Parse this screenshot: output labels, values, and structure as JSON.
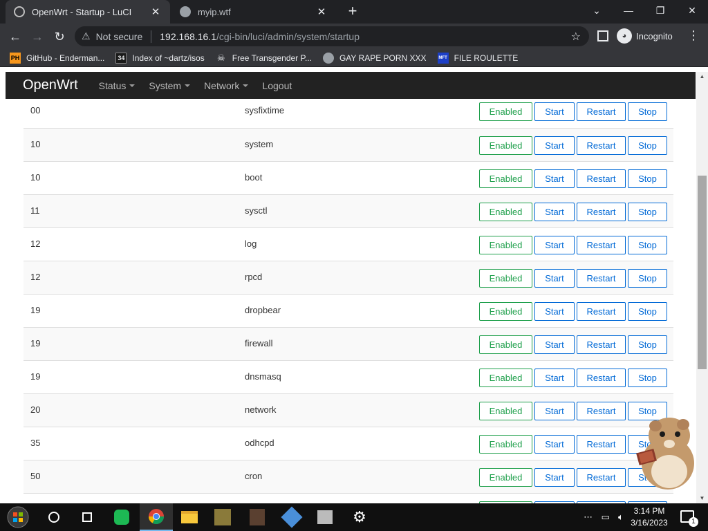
{
  "browser": {
    "tabs": [
      {
        "title": "OpenWrt - Startup - LuCI",
        "active": true
      },
      {
        "title": "myip.wtf",
        "active": false
      }
    ],
    "address": {
      "security": "Not secure",
      "host": "192.168.16.1",
      "path": "/cgi-bin/luci/admin/system/startup"
    },
    "profile_label": "Incognito",
    "bookmarks": [
      {
        "label": "GitHub - Enderman...",
        "icon": "PH"
      },
      {
        "label": "Index of ~dartz/isos",
        "icon": "34"
      },
      {
        "label": "Free Transgender P...",
        "icon": "skull"
      },
      {
        "label": "GAY RAPE PORN XXX",
        "icon": "globe"
      },
      {
        "label": "FILE ROULETTE",
        "icon": "MFT"
      }
    ]
  },
  "luci": {
    "brand": "OpenWrt",
    "nav": [
      "Status",
      "System",
      "Network",
      "Logout"
    ]
  },
  "startup": {
    "buttons": {
      "enabled": "Enabled",
      "start": "Start",
      "restart": "Restart",
      "stop": "Stop"
    },
    "rows": [
      {
        "priority": "00",
        "service": "sysfixtime"
      },
      {
        "priority": "10",
        "service": "system"
      },
      {
        "priority": "10",
        "service": "boot"
      },
      {
        "priority": "11",
        "service": "sysctl"
      },
      {
        "priority": "12",
        "service": "log"
      },
      {
        "priority": "12",
        "service": "rpcd"
      },
      {
        "priority": "19",
        "service": "dropbear"
      },
      {
        "priority": "19",
        "service": "firewall"
      },
      {
        "priority": "19",
        "service": "dnsmasq"
      },
      {
        "priority": "20",
        "service": "network"
      },
      {
        "priority": "35",
        "service": "odhcpd"
      },
      {
        "priority": "50",
        "service": "cron"
      },
      {
        "priority": "",
        "service": ""
      }
    ]
  },
  "taskbar": {
    "time": "3:14 PM",
    "date": "3/16/2023",
    "notification_count": "1"
  }
}
